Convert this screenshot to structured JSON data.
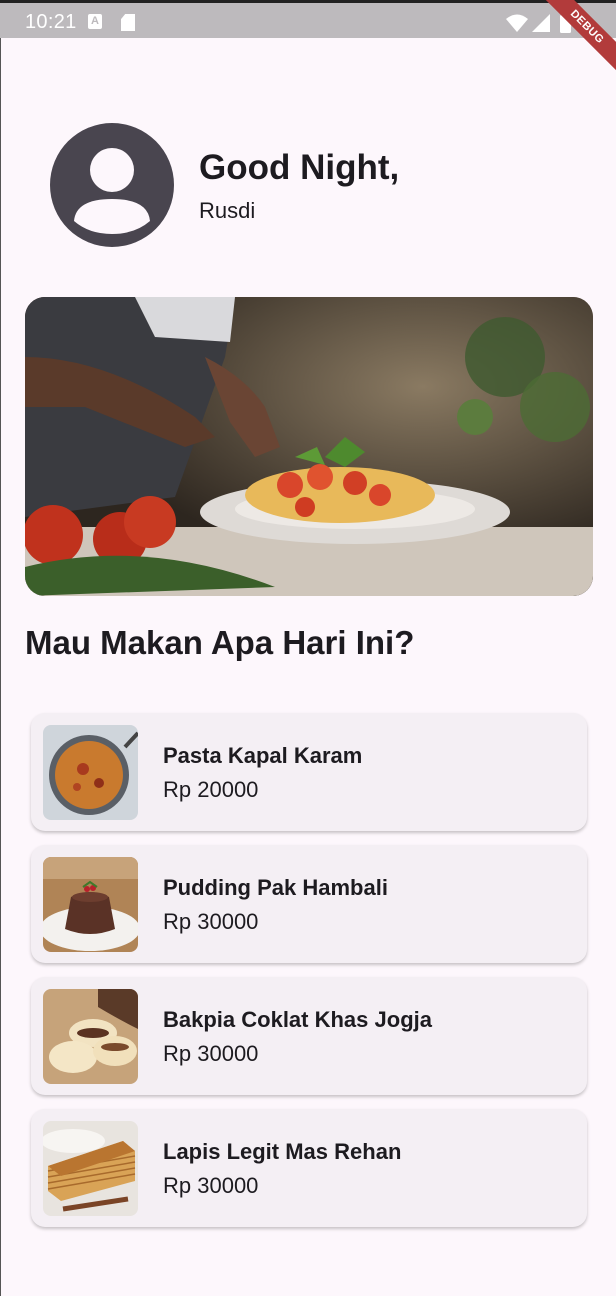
{
  "status_bar": {
    "time": "10:21",
    "notification_icons": [
      "a-icon",
      "sd-card-icon"
    ],
    "right_icons": [
      "wifi-icon",
      "signal-icon",
      "battery-icon"
    ],
    "debug_label": "DEBUG"
  },
  "header": {
    "avatar_icon": "account-circle-icon",
    "greeting": "Good Night,",
    "username": "Rusdi"
  },
  "hero": {
    "image": "chef-plating-pasta-photo"
  },
  "section_title": "Mau Makan Apa Hari Ini?",
  "menu_items": [
    {
      "name": "Pasta Kapal Karam",
      "price": "Rp 20000",
      "image": "pasta-photo"
    },
    {
      "name": "Pudding Pak Hambali",
      "price": "Rp 30000",
      "image": "pudding-photo"
    },
    {
      "name": "Bakpia Coklat Khas Jogja",
      "price": "Rp 30000",
      "image": "bakpia-photo"
    },
    {
      "name": "Lapis Legit Mas Rehan",
      "price": "Rp 30000",
      "image": "lapis-legit-photo"
    }
  ],
  "colors": {
    "background": "#fdf7fc",
    "card": "#f4eff4",
    "avatar": "#49454f",
    "text": "#1d1b20",
    "status_bar": "#bdbabd",
    "debug_ribbon": "#b23b3b"
  }
}
